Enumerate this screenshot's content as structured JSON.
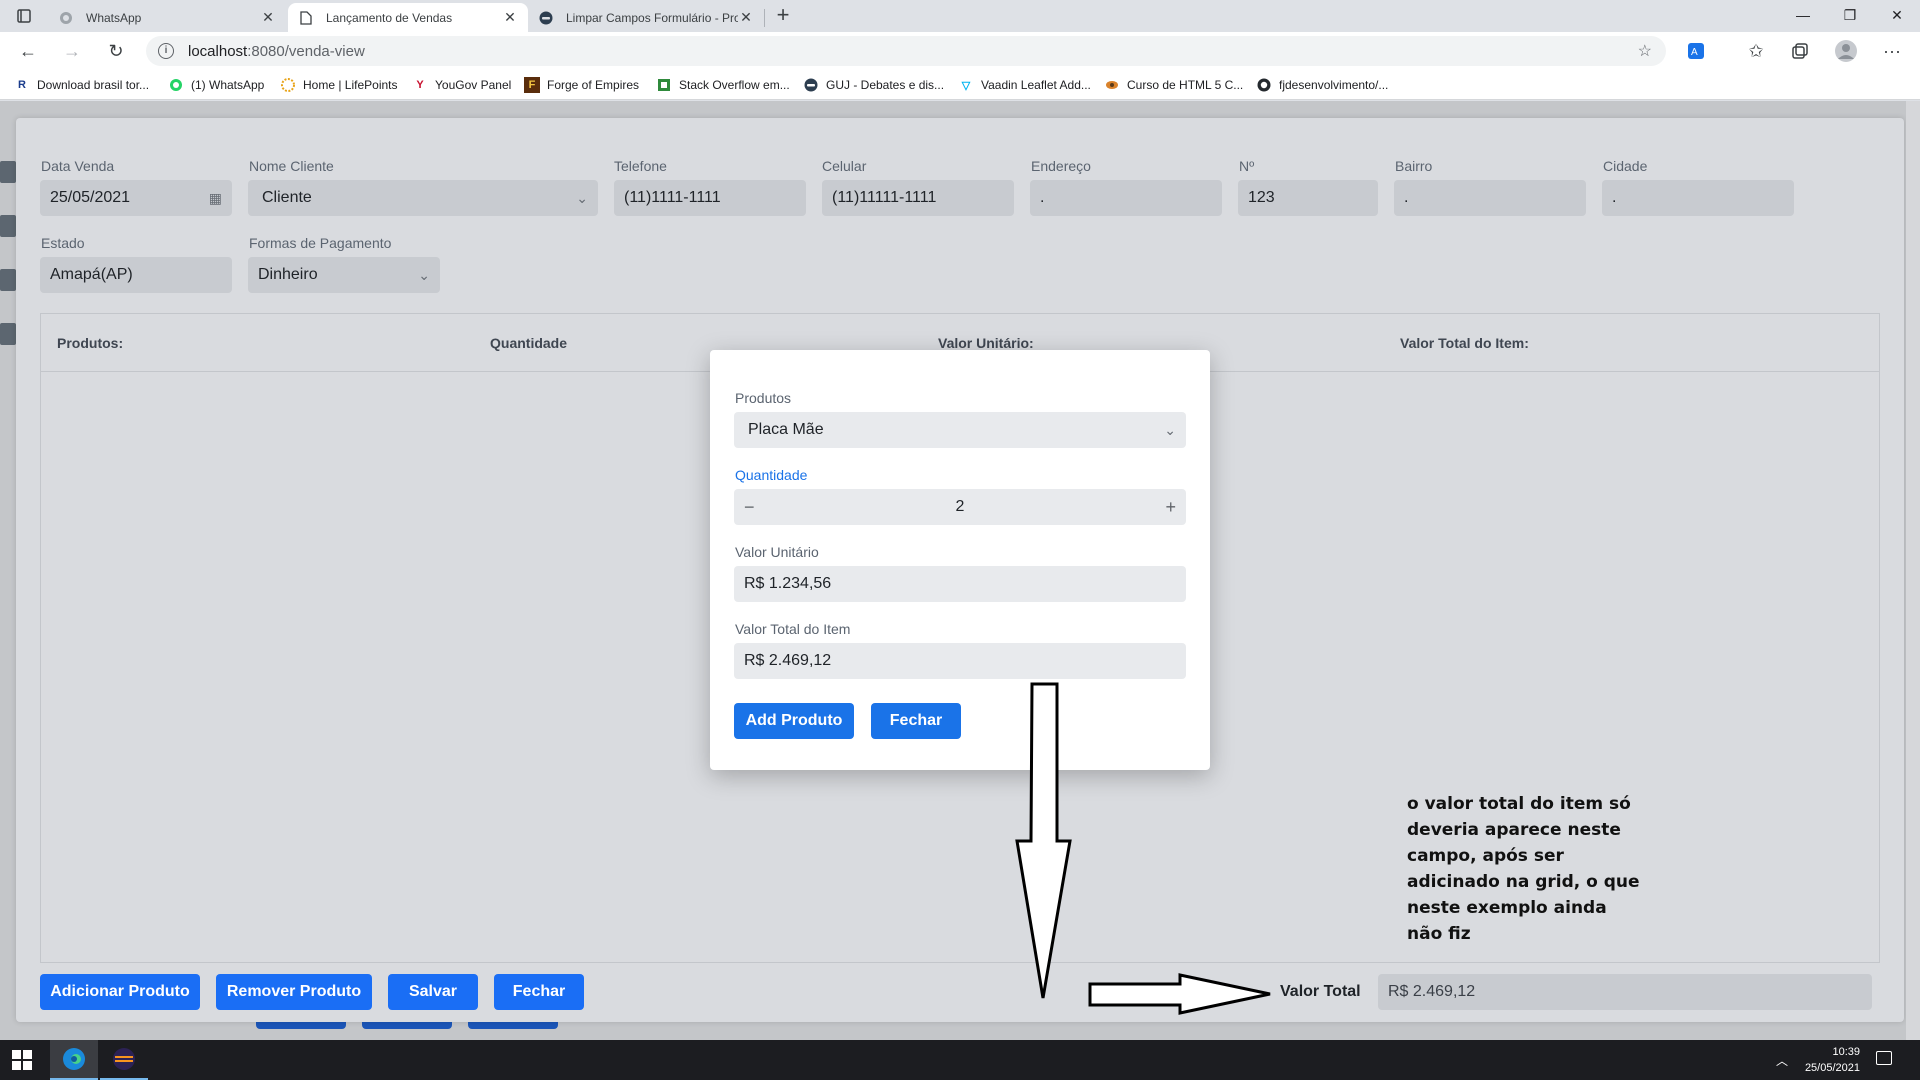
{
  "browser": {
    "tabs": [
      {
        "title": "WhatsApp",
        "favicon": "whatsapp-icon"
      },
      {
        "title": "Lançamento de Vendas",
        "favicon": "page-icon"
      },
      {
        "title": "Limpar Campos Formulário - Pro",
        "favicon": "stackoverflow-icon"
      }
    ],
    "url_host": "localhost",
    "url_path": ":8080/venda-view",
    "bookmarks": [
      {
        "label": "Download brasil tor...",
        "icon": "R"
      },
      {
        "label": "(1) WhatsApp",
        "icon": "whatsapp"
      },
      {
        "label": "Home | LifePoints",
        "icon": "lifepoints"
      },
      {
        "label": "YouGov Panel",
        "icon": "yougov"
      },
      {
        "label": "Forge of Empires",
        "icon": "F"
      },
      {
        "label": "Stack Overflow em...",
        "icon": "so"
      },
      {
        "label": "GUJ - Debates e dis...",
        "icon": "guj"
      },
      {
        "label": "Vaadin Leaflet Add...",
        "icon": "vaadin"
      },
      {
        "label": "Curso de HTML 5 C...",
        "icon": "curso"
      },
      {
        "label": "fjdesenvolvimento/...",
        "icon": "github"
      }
    ]
  },
  "form": {
    "data_venda": {
      "label": "Data Venda",
      "value": "25/05/2021"
    },
    "nome_cliente": {
      "label": "Nome Cliente",
      "value": "Cliente"
    },
    "telefone": {
      "label": "Telefone",
      "value": "(11)1111-1111"
    },
    "celular": {
      "label": "Celular",
      "value": "(11)11111-1111"
    },
    "endereco": {
      "label": "Endereço",
      "value": "."
    },
    "numero": {
      "label": "Nº",
      "value": "123"
    },
    "bairro": {
      "label": "Bairro",
      "value": "."
    },
    "cidade": {
      "label": "Cidade",
      "value": "."
    },
    "estado": {
      "label": "Estado",
      "value": "Amapá(AP)"
    },
    "formas_pagamento": {
      "label": "Formas de Pagamento",
      "value": "Dinheiro"
    }
  },
  "grid": {
    "columns": [
      "Produtos:",
      "Quantidade",
      "Valor Unitário:",
      "Valor Total do Item:"
    ]
  },
  "buttons": {
    "adicionar": "Adicionar Produto",
    "remover": "Remover Produto",
    "salvar": "Salvar",
    "fechar": "Fechar"
  },
  "total": {
    "label": "Valor Total",
    "value": "R$ 2.469,12"
  },
  "dialog": {
    "produtos": {
      "label": "Produtos",
      "value": "Placa Mãe"
    },
    "quantidade": {
      "label": "Quantidade",
      "value": "2"
    },
    "valor_unitario": {
      "label": "Valor Unitário",
      "value": "R$ 1.234,56"
    },
    "valor_total_item": {
      "label": "Valor Total do Item",
      "value": "R$ 2.469,12"
    },
    "add_label": "Add Produto",
    "fechar_label": "Fechar"
  },
  "annotation": "o valor total do item só deveria aparece neste campo, após ser adicinado na grid, o que neste exemplo ainda não fiz",
  "taskbar": {
    "time": "10:39",
    "date": "25/05/2021"
  },
  "colors": {
    "primary": "#1a73e8",
    "focus_label": "#1a73e8"
  }
}
